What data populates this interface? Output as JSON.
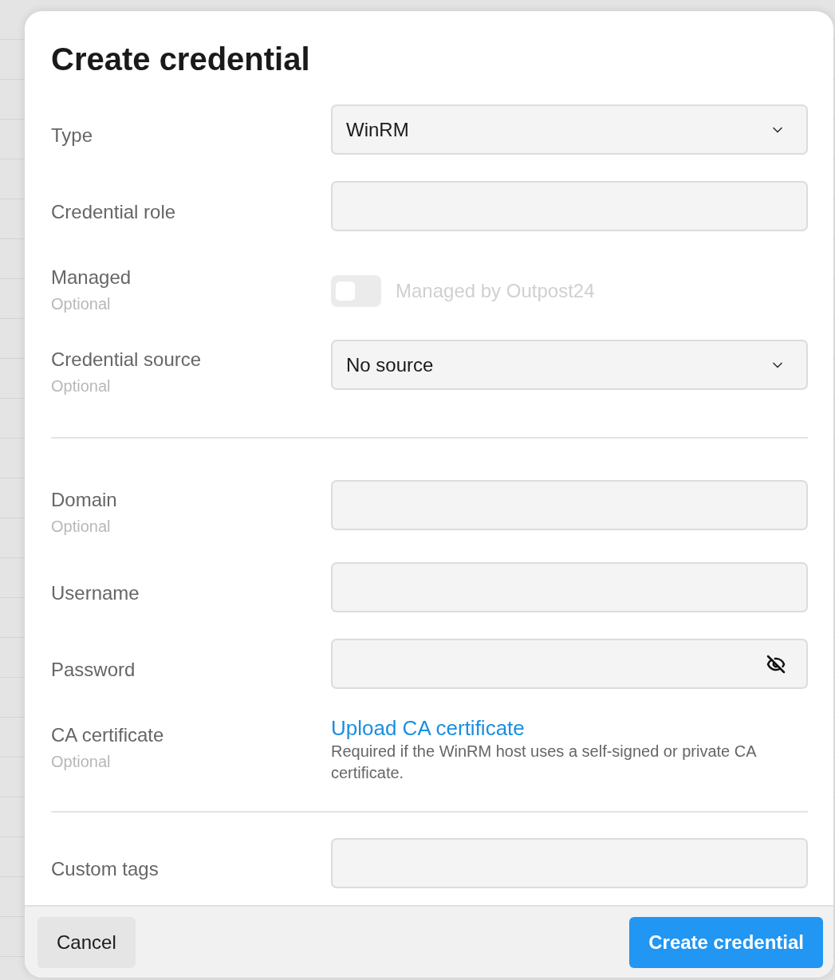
{
  "dialog": {
    "title": "Create credential",
    "sections": [
      {
        "fields": [
          {
            "kind": "select",
            "label": "Type",
            "optional": false,
            "value": "WinRM"
          },
          {
            "kind": "text",
            "label": "Credential role",
            "optional": false
          },
          {
            "kind": "toggle",
            "label": "Managed",
            "optional": true,
            "optional_text": "Optional",
            "on": false,
            "disabled": true,
            "toggle_label": "Managed by Outpost24"
          },
          {
            "kind": "select",
            "label": "Credential source",
            "optional": true,
            "optional_text": "Optional",
            "value": "No source"
          }
        ]
      },
      {
        "fields": [
          {
            "kind": "text",
            "label": "Domain",
            "optional": true,
            "optional_text": "Optional"
          },
          {
            "kind": "text",
            "label": "Username",
            "optional": false
          },
          {
            "kind": "password",
            "label": "Password",
            "optional": false
          },
          {
            "kind": "upload",
            "label": "CA certificate",
            "optional": true,
            "optional_text": "Optional",
            "link": "Upload CA certificate",
            "help": "Required if the WinRM host uses a self-signed or private CA certificate."
          }
        ]
      },
      {
        "fields": [
          {
            "kind": "text",
            "label": "Custom tags",
            "optional": false
          }
        ]
      }
    ],
    "buttons": [
      {
        "kind": "secondary",
        "label": "Cancel"
      },
      {
        "kind": "primary",
        "label": "Create credential"
      }
    ]
  }
}
